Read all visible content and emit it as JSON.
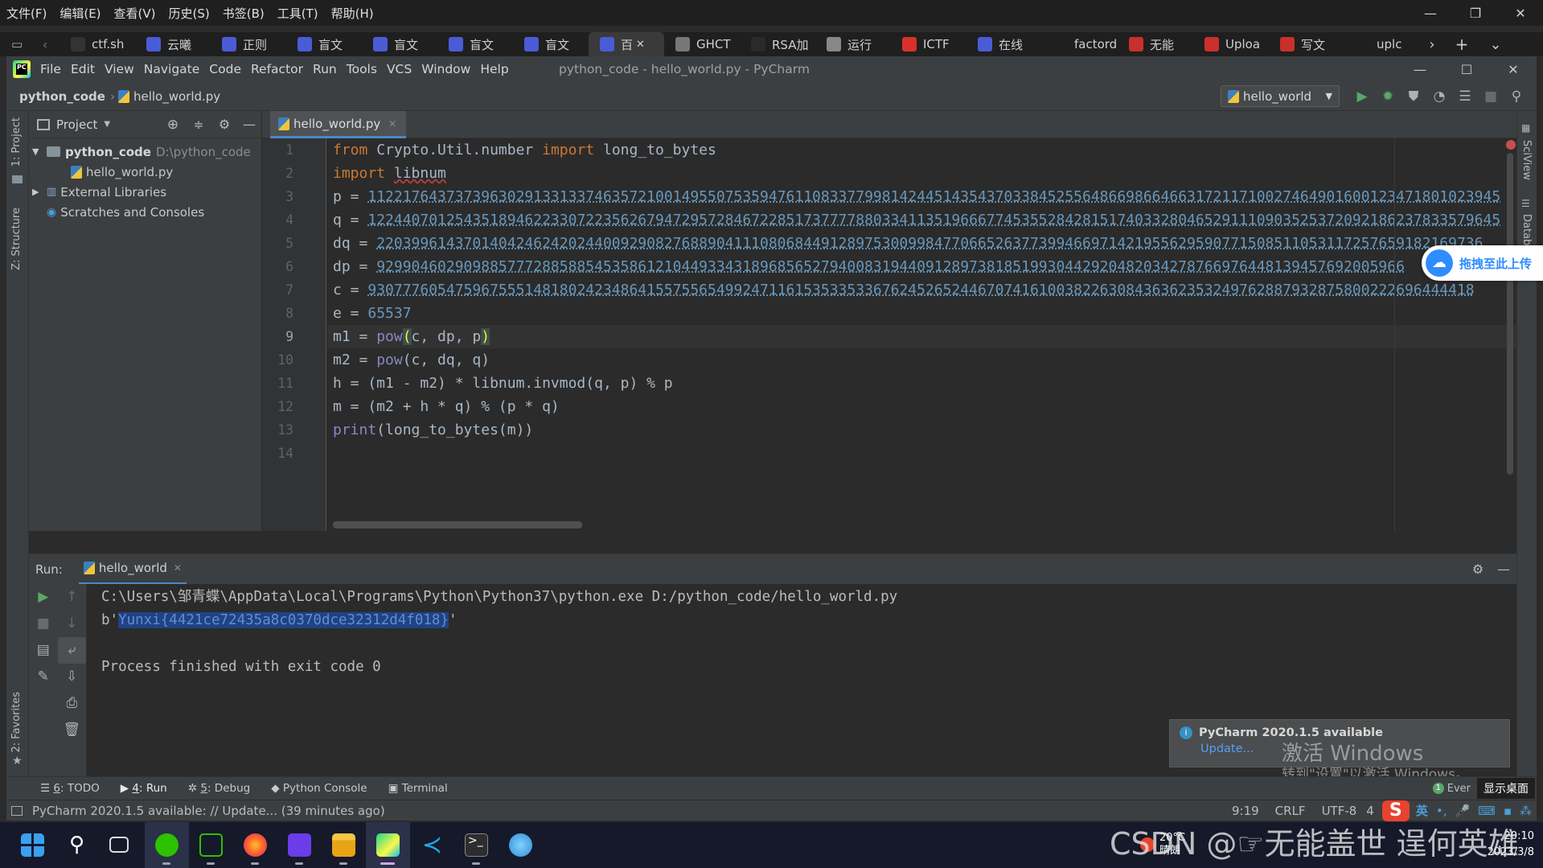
{
  "browser": {
    "menu": [
      "文件(F)",
      "编辑(E)",
      "查看(V)",
      "历史(S)",
      "书签(B)",
      "工具(T)",
      "帮助(H)"
    ],
    "tabs": [
      {
        "label": "ctf.sh",
        "color": "#333333"
      },
      {
        "label": "云曦",
        "color": "#4a5bd6"
      },
      {
        "label": "正则",
        "color": "#4a5bd6"
      },
      {
        "label": "盲文",
        "color": "#4a5bd6"
      },
      {
        "label": "盲文",
        "color": "#4a5bd6"
      },
      {
        "label": "盲文",
        "color": "#4a5bd6"
      },
      {
        "label": "盲文",
        "color": "#4a5bd6"
      },
      {
        "label": "百",
        "color": "#4a5bd6"
      },
      {
        "label": "GHCT",
        "color": "#777777"
      },
      {
        "label": "RSA加",
        "color": "#2a2a2a"
      },
      {
        "label": "运行",
        "color": "#888888"
      },
      {
        "label": "ICTF",
        "color": "#d8312b"
      },
      {
        "label": "在线",
        "color": "#4a5bd6"
      },
      {
        "label": "factordb",
        "color": ""
      },
      {
        "label": "无能",
        "color": "#c9302c"
      },
      {
        "label": "Uploa",
        "color": "#c9302c"
      },
      {
        "label": "写文",
        "color": "#c9302c"
      },
      {
        "label": "uplc",
        "color": ""
      }
    ],
    "new_tab": "+",
    "more_tabs": "›",
    "list_tabs": "⌄"
  },
  "ide": {
    "menu": [
      "File",
      "Edit",
      "View",
      "Navigate",
      "Code",
      "Refactor",
      "Run",
      "Tools",
      "VCS",
      "Window",
      "Help"
    ],
    "title": "python_code - hello_world.py - PyCharm",
    "breadcrumb": {
      "project": "python_code",
      "file": "hello_world.py"
    },
    "run_config": "hello_world",
    "project_panel": {
      "title": "Project",
      "root_name": "python_code",
      "root_path": "D:\\python_code",
      "file": "hello_world.py",
      "external": "External Libraries",
      "scratches": "Scratches and Consoles"
    },
    "left_strip": {
      "project": "1: Project",
      "structure": "Z: Structure",
      "favorites": "2: Favorites"
    },
    "right_strip": {
      "sciview": "SciView",
      "database": "Datab"
    },
    "editor_tab": "hello_world.py",
    "line_numbers": [
      "1",
      "2",
      "3",
      "4",
      "5",
      "6",
      "7",
      "8",
      "9",
      "10",
      "11",
      "12",
      "13",
      "14"
    ],
    "current_line": 9,
    "code": {
      "l1": {
        "kw1": "from",
        "mod": " Crypto.Util.number ",
        "kw2": "import",
        "name": " long_to_bytes"
      },
      "l2": {
        "kw": "import",
        "mod": "libnum"
      },
      "l3": {
        "var": "p = ",
        "num": "1122176437373963029133133746357210014955075359476110833779981424451435437033845255648669866466317211710027464901600123471801023945"
      },
      "l4": {
        "var": "q = ",
        "num": "1224407012543518946223307223562679472957284672285173777788033411351966677453552842815174033280465291110903525372092186237833579645"
      },
      "l5": {
        "var": "dq = ",
        "num": "2203996143701404246242024400929082768890411108068449128975300998477066526377399466971421955629590771508511053117257659182169736"
      },
      "l6": {
        "var": "dp = ",
        "num": "9299046029098857772885885453586121044933431896856527940083194409128973818519930442920482034278766976448139457692005966"
      },
      "l7": {
        "var": "c = ",
        "num": "9307776054759675551481802423486415575565499247116153533533676245265244670741610038226308436362353249762887932875800222696444418"
      },
      "l8": {
        "var": "e = ",
        "num": "65537"
      },
      "l9": {
        "lhs": "m1 = ",
        "fn": "pow",
        "open": "(",
        "args": "c, dp, p",
        "close": ")"
      },
      "l10": {
        "lhs": "m2 = ",
        "fn": "pow",
        "rest": "(c, dq, q)"
      },
      "l11": "h = (m1 - m2) * libnum.invmod(q, p) % p",
      "l12": "m = (m2 + h * q) % (p * q)",
      "l13": {
        "fn": "print",
        "rest": "(long_to_bytes(m))"
      },
      "l14": ""
    },
    "run": {
      "label": "Run:",
      "tab": "hello_world",
      "cmd": "C:\\Users\\邹青蝶\\AppData\\Local\\Programs\\Python\\Python37\\python.exe D:/python_code/hello_world.py",
      "out_prefix": "b'",
      "flag": "Yunxi{4421ce72435a8c0370dce32312d4f018}",
      "out_suffix": "'",
      "exit": "Process finished with exit code 0"
    },
    "notification": {
      "title": "PyCharm 2020.1.5 available",
      "link": "Update..."
    },
    "activate": {
      "line1": "激活 Windows",
      "line2": "转到\"设置\"以激活 Windows。"
    },
    "bottom_tabs": [
      {
        "key": "6",
        "rest": ": TODO",
        "icon": "☰"
      },
      {
        "key": "4",
        "rest": ": Run",
        "icon": "▶"
      },
      {
        "key": "5",
        "rest": ": Debug",
        "icon": "✲"
      },
      {
        "key": "",
        "rest": "Python Console",
        "icon": "◆"
      },
      {
        "key": "",
        "rest": "Terminal",
        "icon": "▣"
      }
    ],
    "status": {
      "message": "PyCharm 2020.1.5 available: // Update... (39 minutes ago)",
      "pos": "9:19",
      "crlf": "CRLF",
      "enc": "UTF-8",
      "indent": "4",
      "event_count": "1",
      "event": "Ever"
    }
  },
  "overlay": {
    "upload": "拖拽至此上传",
    "show_desktop": "显示桌面",
    "watermark": "CSDN @☞无能盖世 逞何英雄",
    "ime": "英"
  },
  "taskbar": {
    "weather": "20°C",
    "weather_desc": "晴朗",
    "time": "20:10",
    "date": "2023/3/8"
  }
}
